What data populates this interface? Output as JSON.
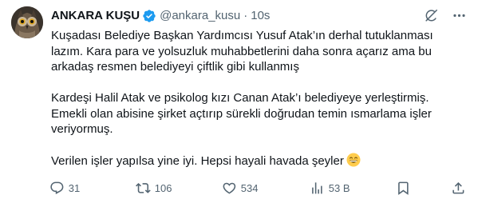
{
  "tweet": {
    "author_name": "ANKARA KUŞU",
    "author_handle": "@ankara_kusu",
    "separator": "·",
    "time": "10s",
    "paragraphs": [
      "Kuşadası Belediye Başkan Yardımcısı Yusuf Atak’ın derhal tutuklanması lazım. Kara para ve yolsuzluk muhabbetlerini daha sonra açarız ama bu arkadaş resmen belediyeyi çiftlik gibi kullanmış",
      "Kardeşi Halil Atak ve psikolog kızı Canan Atak’ı belediyeye yerleştirmiş. Emekli olan abisine şirket açtırıp sürekli doğrudan temin ısmarlama işler veriyormuş.",
      "Verilen işler yapılsa yine iyi. Hepsi hayali havada şeyler"
    ],
    "emoji_icon": "grinning-smiling-eyes-emoji"
  },
  "actions": {
    "replies": "31",
    "reposts": "106",
    "likes": "534",
    "views": "53 B"
  },
  "icons": {
    "verified": "verified-badge-icon",
    "grok": "grok-icon",
    "more": "more-horizontal-icon",
    "reply": "reply-icon",
    "repost": "repost-icon",
    "like": "heart-icon",
    "views": "views-chart-icon",
    "bookmark": "bookmark-icon",
    "share": "share-icon"
  },
  "colors": {
    "text": "#0f1419",
    "secondary": "#536471",
    "verified": "#1d9bf0"
  }
}
